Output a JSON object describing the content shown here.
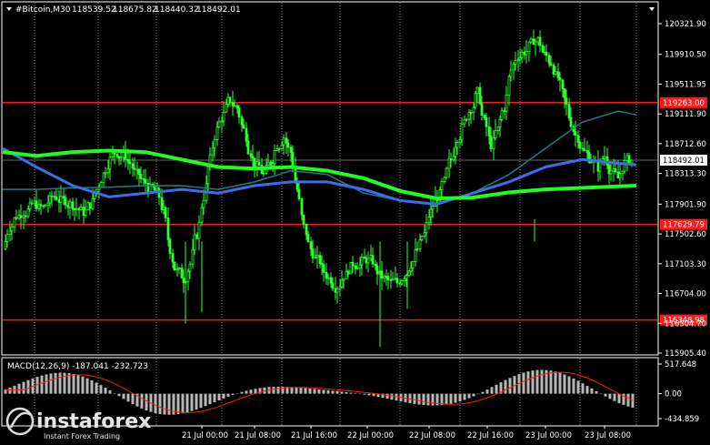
{
  "header": {
    "symbol_label": "#Bitcoin,M30",
    "ohlc": [
      "118539.52",
      "118675.82",
      "118440.32",
      "118492.01"
    ]
  },
  "colors": {
    "background": "#000000",
    "frame": "#ffffff",
    "grid": "#8a8a8a",
    "candle": "#2fff2f",
    "ma_fast": "#3d6ee8",
    "ma_slow": "#1fff1f",
    "ma_teal": "#1d7f8a",
    "level_line": "#ff1a1a",
    "macd_hist": "#b8b8b8",
    "macd_signal": "#ff1a1a"
  },
  "price_axis": {
    "ticks": [
      "120321.90",
      "119910.50",
      "119511.95",
      "119111.90",
      "118712.60",
      "118313.30",
      "117901.90",
      "117502.60",
      "117103.30",
      "116704.00",
      "116304.70",
      "115905.40"
    ],
    "tick_values": [
      120321.9,
      119910.5,
      119511.95,
      119111.9,
      118712.6,
      118313.3,
      117901.9,
      117502.6,
      117103.3,
      116704.0,
      116304.7,
      115905.4
    ],
    "current_price_label": "118492.01",
    "current_price": 118492.01
  },
  "levels": [
    {
      "label": "119263.00",
      "value": 119263.0
    },
    {
      "label": "117629.79",
      "value": 117629.79
    },
    {
      "label": "116348.98",
      "value": 116348.98
    }
  ],
  "time_axis": {
    "labels": [
      "21 Jul 00:00",
      "21 Jul 08:00",
      "21 Jul 16:00",
      "22 Jul 00:00",
      "22 Jul 08:00",
      "22 Jul 16:00",
      "23 Jul 00:00",
      "23 Jul 08:00"
    ]
  },
  "macd": {
    "label": "MACD(12,26,9) -187.041 -232.723",
    "ticks": [
      "517.648",
      "0.00",
      "-434.859"
    ],
    "tick_values": [
      517.648,
      0,
      -434.859
    ]
  },
  "watermark": {
    "brand": "instaforex",
    "tagline": "Instant Forex Trading"
  },
  "chart_data": {
    "type": "candlestick",
    "ylim": [
      115905.4,
      120321.9
    ],
    "close_series": [
      117300,
      117600,
      117750,
      117800,
      117850,
      117900,
      117850,
      117950,
      118000,
      117950,
      117900,
      117850,
      117800,
      117900,
      118100,
      118300,
      118500,
      118600,
      118550,
      118450,
      118300,
      118200,
      118100,
      118050,
      117800,
      117300,
      117000,
      116900,
      117100,
      117500,
      118000,
      118500,
      118900,
      119100,
      119300,
      119200,
      118900,
      118600,
      118400,
      118300,
      118450,
      118700,
      118800,
      118600,
      118100,
      117600,
      117300,
      117150,
      117000,
      116900,
      116800,
      116950,
      117050,
      117100,
      117150,
      117150,
      117000,
      116900,
      116850,
      116850,
      116950,
      117100,
      117300,
      117500,
      117800,
      118000,
      118200,
      118500,
      118800,
      119000,
      119200,
      119400,
      119000,
      118700,
      118900,
      119200,
      119700,
      119900,
      119950,
      120050,
      120100,
      119900,
      119800,
      119600,
      119300,
      119000,
      118800,
      118600,
      118500,
      118400,
      118550,
      118350,
      118250,
      118450,
      118492
    ]
  }
}
